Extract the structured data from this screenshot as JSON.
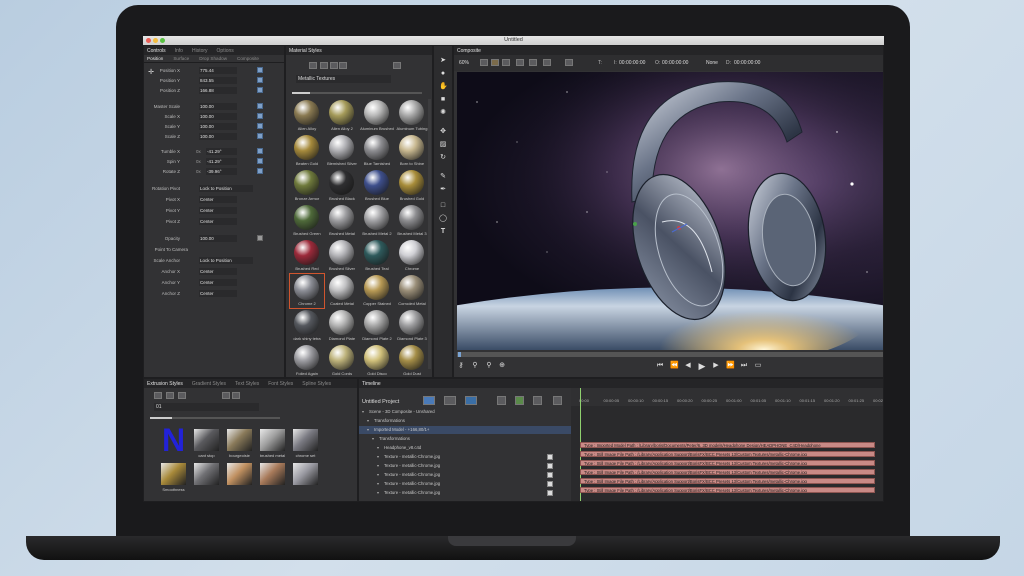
{
  "app": {
    "window_title": "Untitled"
  },
  "controls_panel": {
    "tabs": [
      "Controls",
      "Info",
      "History",
      "Options"
    ],
    "subtabs": [
      "Position",
      "Surface",
      "Drop Shadow",
      "Composite"
    ],
    "properties": [
      {
        "label": "Position X",
        "value": "775.44"
      },
      {
        "label": "Position Y",
        "value": "843.55"
      },
      {
        "label": "Position Z",
        "value": "166.88"
      },
      {
        "label": "Master Scale",
        "value": "100.00"
      },
      {
        "label": "Scale X",
        "value": "100.00"
      },
      {
        "label": "Scale Y",
        "value": "100.00"
      },
      {
        "label": "Scale Z",
        "value": "100.00"
      },
      {
        "label": "Tumble X",
        "unit": "0x",
        "value": "-41.29°"
      },
      {
        "label": "Spin Y",
        "unit": "0x",
        "value": "-41.29°"
      },
      {
        "label": "Rotate Z",
        "unit": "0x",
        "value": "-39.96°"
      },
      {
        "label": "Rotation Pivot",
        "value": "Lock to Position"
      },
      {
        "label": "Pivot X",
        "value": "Center"
      },
      {
        "label": "Pivot Y",
        "value": "Center"
      },
      {
        "label": "Pivot Z",
        "value": "Center"
      },
      {
        "label": "Opacity",
        "value": "100.00"
      },
      {
        "label": "Point To Camera",
        "value": ""
      },
      {
        "label": "Scale Anchor",
        "value": "Lock to Position"
      },
      {
        "label": "Anchor X",
        "value": "Center"
      },
      {
        "label": "Anchor Y",
        "value": "Center"
      },
      {
        "label": "Anchor Z",
        "value": "Center"
      }
    ]
  },
  "material_panel": {
    "tab": "Material Styles",
    "dropdown": "Metallic Textures",
    "materials": [
      {
        "label": "Alien Alloy",
        "color": "#8a7a52"
      },
      {
        "label": "Alien Alloy 2",
        "color": "#a59b5a"
      },
      {
        "label": "Aluminum Brushed",
        "color": "#b8b8b8"
      },
      {
        "label": "Aluminum Tubing",
        "color": "#a8a8a8"
      },
      {
        "label": "Beaten Gold",
        "color": "#a68a3c"
      },
      {
        "label": "Blemished Silver",
        "color": "#b0b0b4"
      },
      {
        "label": "Blue Tarnished",
        "color": "#8e8e92"
      },
      {
        "label": "Born to Shine",
        "color": "#c8b890"
      },
      {
        "label": "Bronze Armor",
        "color": "#6f7a3c"
      },
      {
        "label": "Brushed Black",
        "color": "#2e2e30"
      },
      {
        "label": "Brushed Blue",
        "color": "#3e4f8c"
      },
      {
        "label": "Brushed Gold",
        "color": "#a88d3a"
      },
      {
        "label": "Brushed Green",
        "color": "#4f6a3a"
      },
      {
        "label": "Brushed Metal",
        "color": "#9d9da0"
      },
      {
        "label": "Brushed Metal 2",
        "color": "#a3a3a6"
      },
      {
        "label": "Brushed Metal 3",
        "color": "#8d8d90"
      },
      {
        "label": "Brushed Red",
        "color": "#9c2a3a"
      },
      {
        "label": "Brushed Silver",
        "color": "#b4b4b8"
      },
      {
        "label": "Brushed Teal",
        "color": "#2e5a5c"
      },
      {
        "label": "Chrome",
        "color": "#cfcfd4"
      },
      {
        "label": "Chrome 2",
        "color": "#8c8e96"
      },
      {
        "label": "Coated Metal",
        "color": "#c0c0c2"
      },
      {
        "label": "Copper Stained",
        "color": "#b89a55"
      },
      {
        "label": "Corroded Metal",
        "color": "#9a8e78"
      },
      {
        "label": "dark shiny tetra",
        "color": "#55585e"
      },
      {
        "label": "Diamond Plate",
        "color": "#b4b4b4"
      },
      {
        "label": "Diamond Plate 2",
        "color": "#a8a8a8"
      },
      {
        "label": "Diamond Plate 3",
        "color": "#9e9ea0"
      },
      {
        "label": "Foiled Again",
        "color": "#9d9da2"
      },
      {
        "label": "Gold Cords",
        "color": "#bdb27a"
      },
      {
        "label": "Gold Disco",
        "color": "#d0c07a"
      },
      {
        "label": "Gold Dust",
        "color": "#a58e48"
      }
    ]
  },
  "composite_panel": {
    "tab": "Composite",
    "zoom": "60%",
    "timecode_in": "00:00:00:00",
    "timecode_out": "00:00:00:00",
    "t_label": "T:",
    "in_label": "I:",
    "out_label": "O:",
    "mode": "None",
    "d_label": "D:",
    "d_value": "00:00:00:00"
  },
  "extrusion_panel": {
    "tabs": [
      "Extrusion Styles",
      "Gradient Styles",
      "Text Styles",
      "Font Styles",
      "Spline Styles"
    ],
    "dropdown": "01",
    "items": [
      {
        "label": "",
        "color": "#2222d8"
      },
      {
        "label": "cant stop",
        "color": "#5a5a5e"
      },
      {
        "label": "bourgeoisie",
        "color": "#8a7a5a"
      },
      {
        "label": "brushed metal",
        "color": "#9e9e9e"
      },
      {
        "label": "chrome set",
        "color": "#7a7a82"
      },
      {
        "label": "Smoothness",
        "color": "#a88a3a"
      },
      {
        "label": "",
        "color": "#707074"
      },
      {
        "label": "",
        "color": "#c09060"
      },
      {
        "label": "",
        "color": "#a87a5a"
      },
      {
        "label": "",
        "color": "#9a9aa2"
      }
    ]
  },
  "timeline_panel": {
    "tab": "Timeline",
    "project": "Untitled Project",
    "tree": [
      {
        "label": "Scene - 3D Composite - Unshared",
        "indent": 0
      },
      {
        "label": "Transformations",
        "indent": 1
      },
      {
        "label": "Imported Model - +166,80/1+",
        "indent": 1
      },
      {
        "label": "Transformations",
        "indent": 2
      },
      {
        "label": "Headphone_v8.c4d",
        "indent": 3
      },
      {
        "label": "Texture - metallic-Chrome.jpg",
        "indent": 3
      },
      {
        "label": "Texture - metallic-Chrome.jpg",
        "indent": 3
      },
      {
        "label": "Texture - metallic-Chrome.jpg",
        "indent": 3
      },
      {
        "label": "Texture - metallic-Chrome.jpg",
        "indent": 3
      },
      {
        "label": "Texture - metallic-Chrome.jpg",
        "indent": 3
      }
    ],
    "ruler": [
      "00:00",
      "00:00:05",
      "00:00:10",
      "00:00:15",
      "00:00:20",
      "00:00:25",
      "00:01:00",
      "00:01:05",
      "00:01:10",
      "00:01:15",
      "00:01:20",
      "00:01:25",
      "00:02:00"
    ],
    "tracks": [
      "Type : Imported Model     Path : /Library/boris/Documents/Peter/6. 3D models/Headphone Design/HEADPHONE_C4D/Headphone",
      "Type : Still Image File     Path : /Library/Application Support/BorisFX/BCC Presets 13/Custom Textures/metallic-Chrome.jpg",
      "Type : Still Image File     Path : /Library/Application Support/BorisFX/BCC Presets 13/Custom Textures/metallic-Chrome.jpg",
      "Type : Still Image File     Path : /Library/Application Support/BorisFX/BCC Presets 13/Custom Textures/metallic-Chrome.jpg",
      "Type : Still Image File     Path : /Library/Application Support/BorisFX/BCC Presets 13/Custom Textures/metallic-Chrome.jpg",
      "Type : Still Image File     Path : /Library/Application Support/BorisFX/BCC Presets 13/Custom Textures/metallic-Chrome.jpg"
    ]
  },
  "colors": {
    "accent_blue": "#3a6ea5",
    "track_red": "#c98a86",
    "panel_bg": "#323234"
  }
}
